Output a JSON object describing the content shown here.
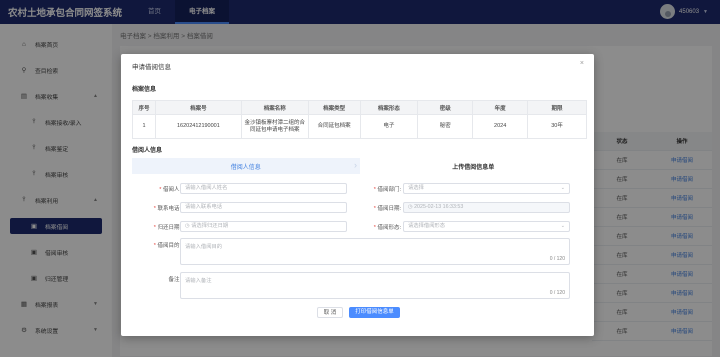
{
  "app": {
    "title": "农村土地承包合同网签系统",
    "nav": [
      "首页",
      "电子档案"
    ],
    "active_nav": "电子档案",
    "user": "450603"
  },
  "sidebar": {
    "items": [
      {
        "label": "档案首页",
        "icon": "home-icon"
      },
      {
        "label": "查目检索",
        "icon": "search-icon"
      },
      {
        "label": "档案收集",
        "icon": "folder-icon"
      },
      {
        "label": "档案接收/录入",
        "icon": "tree-icon"
      },
      {
        "label": "档案鉴定",
        "icon": "tree-icon"
      },
      {
        "label": "档案审核",
        "icon": "tree-icon"
      },
      {
        "label": "档案利用",
        "icon": "tree-icon"
      },
      {
        "label": "档案借阅",
        "icon": "doc-icon"
      },
      {
        "label": "借阅审核",
        "icon": "doc-icon"
      },
      {
        "label": "归还管理",
        "icon": "doc-icon"
      },
      {
        "label": "档案报表",
        "icon": "report-icon"
      },
      {
        "label": "系统设置",
        "icon": "gear-icon"
      }
    ]
  },
  "breadcrumb": "电子档案 > 档案利用 > 档案借阅",
  "background_table": {
    "header": [
      "状态",
      "操作"
    ],
    "rows": [
      [
        "在库",
        "申请借阅"
      ],
      [
        "在库",
        "申请借阅"
      ],
      [
        "在库",
        "申请借阅"
      ],
      [
        "在库",
        "申请借阅"
      ],
      [
        "在库",
        "申请借阅"
      ],
      [
        "在库",
        "申请借阅"
      ],
      [
        "在库",
        "申请借阅"
      ],
      [
        "在库",
        "申请借阅"
      ],
      [
        "在库",
        "申请借阅"
      ],
      [
        "在库",
        "申请借阅"
      ]
    ]
  },
  "modal": {
    "title": "申请借阅信息",
    "close": "×",
    "archive_section": "档案信息",
    "table": {
      "headers": [
        "序号",
        "档案号",
        "档案名称",
        "档案类型",
        "档案形态",
        "密级",
        "年度",
        "期限"
      ],
      "row": [
        "1",
        "16202412190001",
        "金沙镇板寨村潭二组的合同延包申请电子档案",
        "合同延包档案",
        "电子",
        "秘密",
        "2024",
        "30年"
      ]
    },
    "borrower_section": "借阅人信息",
    "steps": [
      "借阅人信息",
      "上传借阅信息单"
    ],
    "form": {
      "borrower": {
        "label": "借阅人:",
        "placeholder": "请输入借阅人姓名"
      },
      "department": {
        "label": "借阅部门:",
        "placeholder": "请选择"
      },
      "phone": {
        "label": "联系电话:",
        "placeholder": "请输入联系电话"
      },
      "borrow_date": {
        "label": "借阅日期:",
        "value": "2025-02-13 16:33:53"
      },
      "return_date": {
        "label": "归还日期:",
        "placeholder": "请选择归还日期"
      },
      "borrow_form": {
        "label": "借阅形态:",
        "placeholder": "请选择借阅形态"
      },
      "purpose": {
        "label": "借阅目的:",
        "placeholder": "请输入借阅目的",
        "count": "0 / 120"
      },
      "remark": {
        "label": "备注:",
        "placeholder": "请输入备注",
        "count": "0 / 120"
      }
    },
    "buttons": {
      "cancel": "取 消",
      "print": "打印借阅信息单"
    }
  }
}
